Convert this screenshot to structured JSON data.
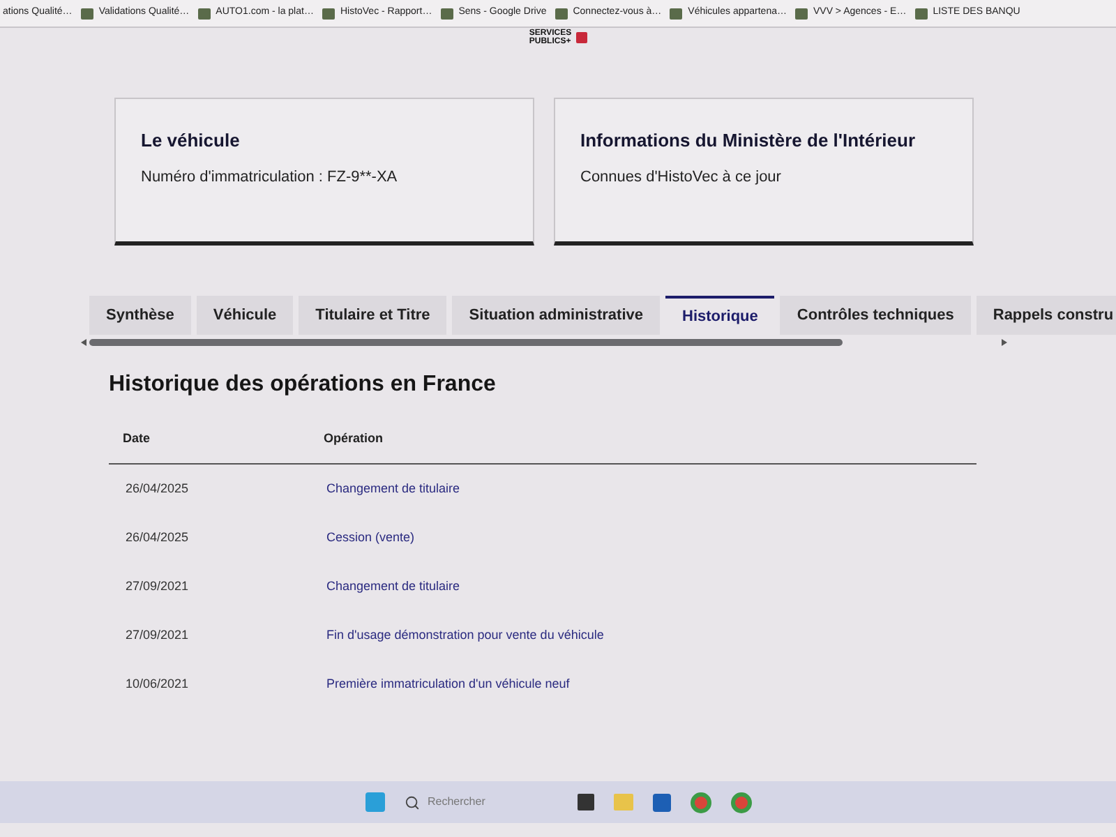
{
  "bookmarks": [
    {
      "label": "ations Qualité…"
    },
    {
      "label": "Validations Qualité…"
    },
    {
      "label": "AUTO1.com - la plat…"
    },
    {
      "label": "HistoVec - Rapport…"
    },
    {
      "label": "Sens - Google Drive"
    },
    {
      "label": "Connectez-vous à…"
    },
    {
      "label": "Véhicules appartena…"
    },
    {
      "label": "VVV > Agences - E…"
    },
    {
      "label": "LISTE DES BANQU"
    }
  ],
  "logo": {
    "line_1": "SERVICES",
    "line_2": "PUBLICS+"
  },
  "cards": [
    {
      "title": "Le véhicule",
      "text": "Numéro d'immatriculation : FZ-9**-XA"
    },
    {
      "title": "Informations du Ministère de l'Intérieur",
      "text": "Connues d'HistoVec à ce jour"
    }
  ],
  "tabs": [
    {
      "label": "Synthèse",
      "selected": false
    },
    {
      "label": "Véhicule",
      "selected": false
    },
    {
      "label": "Titulaire et Titre",
      "selected": false
    },
    {
      "label": "Situation administrative",
      "selected": false
    },
    {
      "label": "Historique",
      "selected": true
    },
    {
      "label": "Contrôles techniques",
      "selected": false
    },
    {
      "label": "Rappels constru",
      "selected": false
    }
  ],
  "section": {
    "title": "Historique des opérations en France",
    "columns": [
      "Date",
      "Opération"
    ],
    "rows": [
      {
        "date": "26/04/2025",
        "operation": "Changement de titulaire"
      },
      {
        "date": "26/04/2025",
        "operation": "Cession (vente)"
      },
      {
        "date": "27/09/2021",
        "operation": "Changement de titulaire"
      },
      {
        "date": "27/09/2021",
        "operation": "Fin d'usage démonstration pour vente du véhicule"
      },
      {
        "date": "10/06/2021",
        "operation": "Première immatriculation d'un véhicule neuf"
      }
    ]
  },
  "taskbar": {
    "search_placeholder": "Rechercher"
  }
}
